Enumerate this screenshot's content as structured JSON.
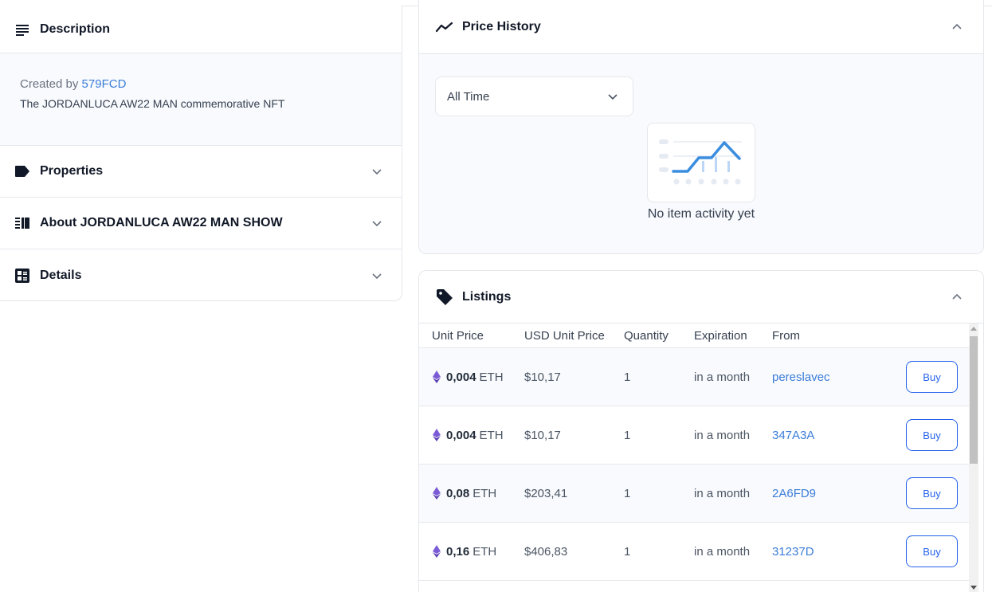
{
  "left": {
    "description": {
      "title": "Description",
      "created_prefix": "Created by",
      "creator": "579FCD",
      "text": "The JORDANLUCA AW22 MAN commemorative NFT"
    },
    "properties": {
      "title": "Properties"
    },
    "about": {
      "title": "About JORDANLUCA AW22 MAN SHOW"
    },
    "details": {
      "title": "Details"
    }
  },
  "price_history": {
    "title": "Price History",
    "range_select": "All Time",
    "empty_text": "No item activity yet"
  },
  "listings": {
    "title": "Listings",
    "columns": [
      "Unit Price",
      "USD Unit Price",
      "Quantity",
      "Expiration",
      "From"
    ],
    "rows": [
      {
        "amount": "0,004",
        "currency": "ETH",
        "usd": "$10,17",
        "quantity": "1",
        "expiration": "in a month",
        "from": "pereslavec",
        "action": "Buy"
      },
      {
        "amount": "0,004",
        "currency": "ETH",
        "usd": "$10,17",
        "quantity": "1",
        "expiration": "in a month",
        "from": "347A3A",
        "action": "Buy"
      },
      {
        "amount": "0,08",
        "currency": "ETH",
        "usd": "$203,41",
        "quantity": "1",
        "expiration": "in a month",
        "from": "2A6FD9",
        "action": "Buy"
      },
      {
        "amount": "0,16",
        "currency": "ETH",
        "usd": "$406,83",
        "quantity": "1",
        "expiration": "in a month",
        "from": "31237D",
        "action": "Buy"
      }
    ]
  },
  "colors": {
    "link": "#3b7dd8",
    "button": "#2563eb",
    "panel_bg": "#f8fafd",
    "border": "#e5e7eb",
    "eth": "#7c5cd6"
  },
  "icons": {
    "description": "list-lines-icon",
    "properties": "tag-label-icon",
    "about": "collection-icon",
    "details": "details-grid-icon",
    "price_history": "trend-line-icon",
    "listings": "price-tag-icon",
    "eth": "ethereum-icon"
  }
}
